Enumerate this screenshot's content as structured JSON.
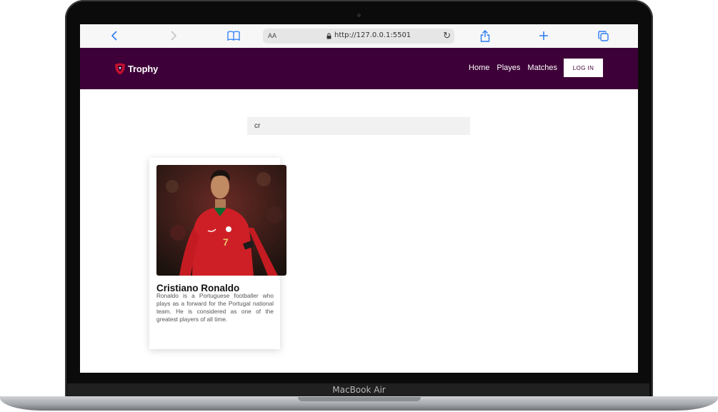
{
  "device": {
    "model_label": "MacBook Air"
  },
  "browser": {
    "text_size_label": "AA",
    "url": "http://127.0.0.1:5501",
    "icons": [
      "chevron-left-icon",
      "chevron-right-icon",
      "book-icon",
      "lock-icon",
      "reload-icon",
      "share-icon",
      "plus-icon",
      "tabs-icon"
    ]
  },
  "site": {
    "logo_text": "Trophy",
    "nav": [
      {
        "label": "Home"
      },
      {
        "label": "Playes"
      },
      {
        "label": "Matches"
      }
    ],
    "login_label": "LOG IN",
    "colors": {
      "brand": "#3e0038",
      "accent": "#c8102e"
    }
  },
  "search": {
    "value": "cr"
  },
  "players": [
    {
      "name": "Cristiano Ronaldo",
      "description": "Ronaldo is a Portuguese footballer who plays as a forward for the Portugal national team. He is considered as one of the greatest players of all time.",
      "jersey_number": "7"
    }
  ]
}
